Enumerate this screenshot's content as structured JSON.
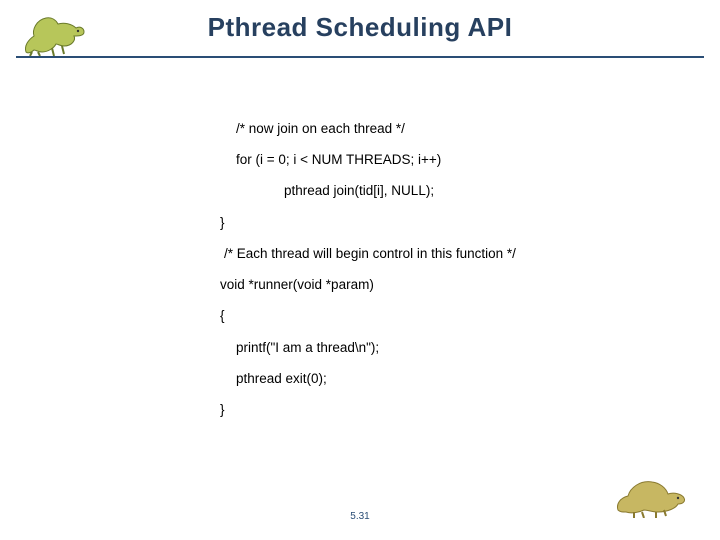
{
  "title": "Pthread Scheduling API",
  "code": {
    "l1": "/* now join on each thread */",
    "l2": "for (i = 0; i < NUM THREADS; i++)",
    "l3": "pthread join(tid[i], NULL);",
    "l4": "}",
    "l5": "/* Each thread will begin control in this function */",
    "l6": "void *runner(void *param)",
    "l7": "{",
    "l8": "printf(\"I am a thread\\n\");",
    "l9": "pthread exit(0);",
    "l10": "}"
  },
  "page_number": "5.31",
  "colors": {
    "title": "#27405f",
    "rule": "#2a4d75"
  },
  "icons": {
    "top_dino": "dinosaur-running",
    "bottom_dino": "dinosaur-standing"
  }
}
